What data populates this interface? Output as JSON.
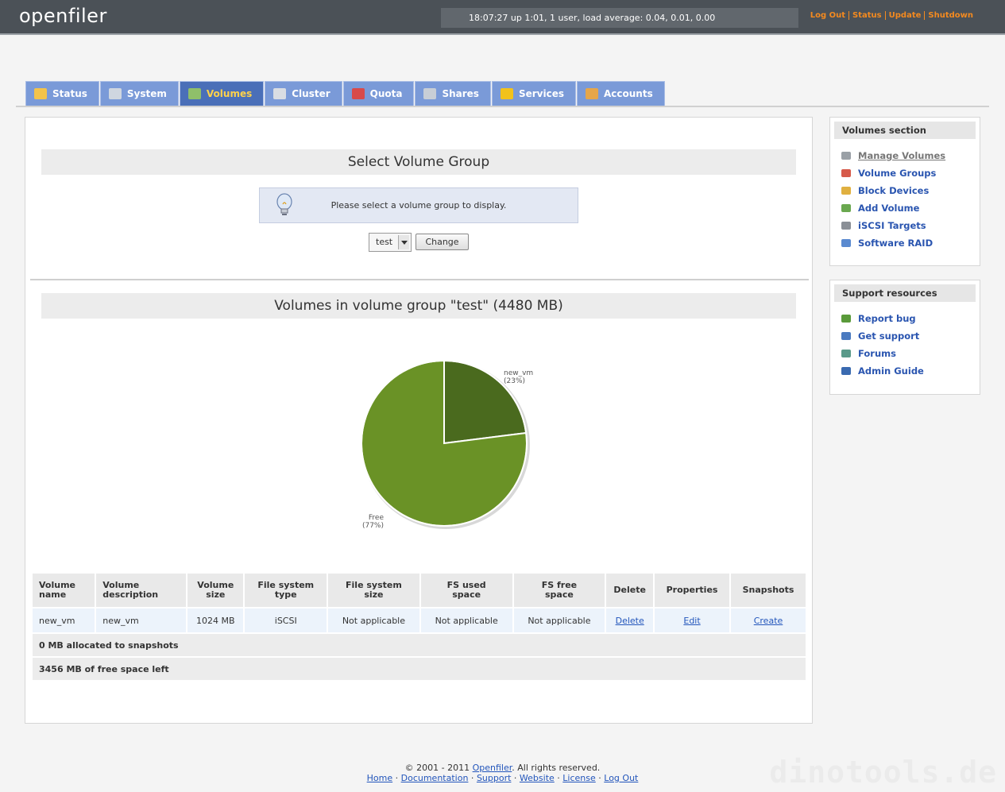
{
  "header": {
    "logo": "openfiler",
    "uptime": "18:07:27 up 1:01, 1 user, load average: 0.04, 0.01, 0.00",
    "links": [
      "Log Out",
      "Status",
      "Update",
      "Shutdown"
    ]
  },
  "tabs": [
    {
      "label": "Status",
      "icon": "sun-cloud-icon",
      "color": "#f3c34a"
    },
    {
      "label": "System",
      "icon": "monitor-icon",
      "color": "#cfd6e0"
    },
    {
      "label": "Volumes",
      "icon": "disk-icon",
      "color": "#8fbf6a",
      "active": true
    },
    {
      "label": "Cluster",
      "icon": "servers-icon",
      "color": "#d9dde3"
    },
    {
      "label": "Quota",
      "icon": "pie-icon",
      "color": "#d84a4a"
    },
    {
      "label": "Shares",
      "icon": "drive-icon",
      "color": "#c8ced6"
    },
    {
      "label": "Services",
      "icon": "lightning-icon",
      "color": "#f2c21b"
    },
    {
      "label": "Accounts",
      "icon": "users-icon",
      "color": "#e6a64a"
    }
  ],
  "select_section": {
    "title": "Select Volume Group",
    "info": "Please select a volume group to display.",
    "selected_vg": "test",
    "change_label": "Change"
  },
  "volumes_section": {
    "title": "Volumes in volume group \"test\" (4480 MB)"
  },
  "chart_data": {
    "type": "pie",
    "labels": [
      "new_vm",
      "Free"
    ],
    "values": [
      23,
      77
    ],
    "value_labels": [
      "(23%)",
      "(77%)"
    ],
    "colors": [
      "#4a6a1e",
      "#6a9226"
    ]
  },
  "table": {
    "headers": [
      [
        "Volume",
        "name"
      ],
      [
        "Volume",
        "description"
      ],
      [
        "Volume",
        "size"
      ],
      [
        "File system",
        "type"
      ],
      [
        "File system",
        "size"
      ],
      [
        "FS used",
        "space"
      ],
      [
        "FS free",
        "space"
      ],
      [
        "Delete",
        ""
      ],
      [
        "Properties",
        ""
      ],
      [
        "Snapshots",
        ""
      ]
    ],
    "rows": [
      {
        "name": "new_vm",
        "description": "new_vm",
        "size": "1024 MB",
        "fs_type": "iSCSI",
        "fs_size": "Not applicable",
        "fs_used": "Not applicable",
        "fs_free": "Not applicable",
        "delete": "Delete",
        "properties": "Edit",
        "snapshots": "Create"
      }
    ],
    "summary_snapshots": "0 MB allocated to snapshots",
    "summary_free": "3456 MB of free space left"
  },
  "sidebar": {
    "volumes_title": "Volumes section",
    "volumes_items": [
      {
        "label": "Manage Volumes",
        "icon": "volume-icon",
        "color": "#9aa0a6",
        "current": true
      },
      {
        "label": "Volume Groups",
        "icon": "volume-groups-icon",
        "color": "#d65a4a"
      },
      {
        "label": "Block Devices",
        "icon": "block-devices-icon",
        "color": "#e0b040"
      },
      {
        "label": "Add Volume",
        "icon": "add-volume-icon",
        "color": "#6aa84f"
      },
      {
        "label": "iSCSI Targets",
        "icon": "iscsi-icon",
        "color": "#8a8f96"
      },
      {
        "label": "Software RAID",
        "icon": "raid-icon",
        "color": "#5a8ad0"
      }
    ],
    "support_title": "Support resources",
    "support_items": [
      {
        "label": "Report bug",
        "icon": "bug-icon",
        "color": "#5a9a3a"
      },
      {
        "label": "Get support",
        "icon": "support-icon",
        "color": "#4a7ac0"
      },
      {
        "label": "Forums",
        "icon": "forums-icon",
        "color": "#5a9a8a"
      },
      {
        "label": "Admin Guide",
        "icon": "book-icon",
        "color": "#3a6ab0"
      }
    ]
  },
  "footer": {
    "copyright_prefix": "© 2001 - 2011 ",
    "copyright_link": "Openfiler",
    "copyright_suffix": ". All rights reserved.",
    "links": [
      "Home",
      "Documentation",
      "Support",
      "Website",
      "License",
      "Log Out"
    ]
  },
  "watermark": "dinotools.de"
}
